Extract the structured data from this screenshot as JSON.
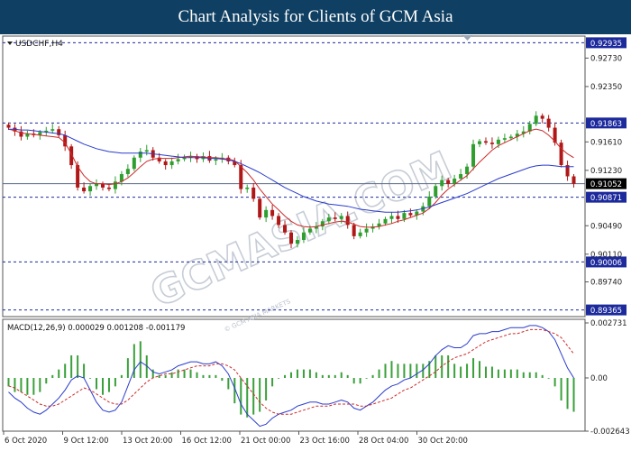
{
  "header": {
    "title": "Chart Analysis for Clients of GCM Asia"
  },
  "watermark": {
    "text": "GCMASIA.COM",
    "subtext": "© GCM ASIA MARKETS"
  },
  "colors": {
    "header_bg": "#0f3f62",
    "bull_candle": "#2e9e2e",
    "bear_candle": "#b01818",
    "ma_fast": "#cc2a2a",
    "ma_slow": "#2a3ccc",
    "level_line": "#1c2a9c",
    "price_line": "#5a6a8a",
    "macd_hist": "#3aa03a"
  },
  "chart_data": [
    {
      "type": "candlestick",
      "symbol": "USDCHF,H4",
      "ylim": [
        0.893,
        0.93
      ],
      "x_tick_labels": [
        "6 Oct 2020",
        "9 Oct 12:00",
        "13 Oct 20:00",
        "16 Oct 12:00",
        "21 Oct 00:00",
        "23 Oct 16:00",
        "28 Oct 04:00",
        "30 Oct 20:00"
      ],
      "y_tick_labels": [
        "0.92730",
        "0.92350",
        "0.91610",
        "0.91230",
        "0.90490",
        "0.90110",
        "0.89740"
      ],
      "levels": [
        {
          "value": 0.92935,
          "label": "0.92935"
        },
        {
          "value": 0.91863,
          "label": "0.91863"
        },
        {
          "value": 0.90871,
          "label": "0.90871"
        },
        {
          "value": 0.90006,
          "label": "0.90006"
        },
        {
          "value": 0.89365,
          "label": "0.89365"
        }
      ],
      "current_price": {
        "value": 0.91052,
        "label": "0.91052"
      },
      "series": [
        {
          "name": "close",
          "values": [
            0.918,
            0.9175,
            0.9168,
            0.9172,
            0.917,
            0.9174,
            0.9176,
            0.9178,
            0.917,
            0.9155,
            0.913,
            0.91,
            0.9095,
            0.9102,
            0.9105,
            0.91,
            0.9098,
            0.9108,
            0.9118,
            0.9125,
            0.914,
            0.9148,
            0.915,
            0.914,
            0.9135,
            0.913,
            0.9135,
            0.9138,
            0.914,
            0.9142,
            0.9138,
            0.9142,
            0.9136,
            0.9138,
            0.914,
            0.9135,
            0.913,
            0.9098,
            0.91,
            0.9085,
            0.906,
            0.907,
            0.9062,
            0.905,
            0.904,
            0.9025,
            0.903,
            0.904,
            0.9045,
            0.9048,
            0.9055,
            0.906,
            0.9058,
            0.9062,
            0.905,
            0.9035,
            0.904,
            0.9045,
            0.9048,
            0.9052,
            0.9058,
            0.9062,
            0.9058,
            0.9066,
            0.9063,
            0.9068,
            0.9075,
            0.9088,
            0.9102,
            0.911,
            0.9105,
            0.9112,
            0.9118,
            0.9128,
            0.9158,
            0.9162,
            0.916,
            0.9158,
            0.9164,
            0.9166,
            0.9168,
            0.9172,
            0.9175,
            0.9185,
            0.9196,
            0.9192,
            0.918,
            0.916,
            0.913,
            0.9115,
            0.9105
          ]
        },
        {
          "name": "MA(fast)",
          "values": [
            0.9178,
            0.9176,
            0.9173,
            0.9172,
            0.9171,
            0.917,
            0.9169,
            0.9168,
            0.9167,
            0.916,
            0.9145,
            0.9128,
            0.9116,
            0.9108,
            0.9105,
            0.9105,
            0.9104,
            0.9105,
            0.9108,
            0.9113,
            0.912,
            0.9128,
            0.9135,
            0.9138,
            0.9139,
            0.9139,
            0.9139,
            0.914,
            0.9141,
            0.9142,
            0.9141,
            0.9141,
            0.914,
            0.914,
            0.9139,
            0.9138,
            0.9136,
            0.9128,
            0.912,
            0.911,
            0.9098,
            0.9088,
            0.9078,
            0.907,
            0.9062,
            0.9055,
            0.905,
            0.9048,
            0.9047,
            0.9048,
            0.905,
            0.9052,
            0.9054,
            0.9055,
            0.9054,
            0.9051,
            0.9048,
            0.9047,
            0.9047,
            0.9048,
            0.905,
            0.9052,
            0.9055,
            0.9057,
            0.906,
            0.9063,
            0.9066,
            0.9072,
            0.908,
            0.909,
            0.9098,
            0.9104,
            0.911,
            0.9116,
            0.9125,
            0.9134,
            0.9142,
            0.915,
            0.9156,
            0.916,
            0.9164,
            0.9168,
            0.9172,
            0.9176,
            0.9178,
            0.9176,
            0.917,
            0.9162,
            0.9152,
            0.9145,
            0.914
          ]
        },
        {
          "name": "MA(slow)",
          "values": [
            0.9178,
            0.9178,
            0.9177,
            0.9177,
            0.9176,
            0.9175,
            0.9174,
            0.9173,
            0.9172,
            0.917,
            0.9166,
            0.9162,
            0.9158,
            0.9155,
            0.9152,
            0.915,
            0.9148,
            0.9147,
            0.9146,
            0.9146,
            0.9146,
            0.9146,
            0.9146,
            0.9145,
            0.9144,
            0.9143,
            0.9142,
            0.9141,
            0.914,
            0.914,
            0.914,
            0.914,
            0.9139,
            0.9139,
            0.9138,
            0.9137,
            0.9135,
            0.9132,
            0.9128,
            0.9124,
            0.912,
            0.9115,
            0.911,
            0.9105,
            0.91,
            0.9096,
            0.9092,
            0.9088,
            0.9085,
            0.9082,
            0.908,
            0.9078,
            0.9077,
            0.9076,
            0.9075,
            0.9073,
            0.9071,
            0.907,
            0.9069,
            0.9068,
            0.9067,
            0.9067,
            0.9067,
            0.9068,
            0.9069,
            0.907,
            0.9072,
            0.9074,
            0.9077,
            0.908,
            0.9083,
            0.9086,
            0.9089,
            0.9092,
            0.9096,
            0.91,
            0.9104,
            0.9108,
            0.9112,
            0.9115,
            0.9118,
            0.9121,
            0.9124,
            0.9127,
            0.9129,
            0.913,
            0.913,
            0.9129,
            0.9128,
            0.9128,
            0.9128
          ]
        }
      ]
    },
    {
      "type": "line",
      "title": "MACD(12,26,9) 0.000029 0.001208 -0.001179",
      "ylim": [
        -0.002643,
        0.002731
      ],
      "y_tick_labels": [
        "0.002731",
        "0.00",
        "-0.002643"
      ],
      "series": [
        {
          "name": "MACD",
          "values": [
            -0.0007,
            -0.001,
            -0.0012,
            -0.0015,
            -0.0017,
            -0.0018,
            -0.0016,
            -0.0013,
            -0.001,
            -0.0006,
            -0.0001,
            0.0001,
            0.0,
            -0.0006,
            -0.0012,
            -0.0016,
            -0.0017,
            -0.0016,
            -0.0012,
            -0.0004,
            0.0004,
            0.0008,
            0.0006,
            0.0003,
            0.0002,
            0.0003,
            0.0004,
            0.0006,
            0.0007,
            0.0008,
            0.0008,
            0.0007,
            0.0007,
            0.0008,
            0.0006,
            0.0002,
            -0.0005,
            -0.0013,
            -0.0018,
            -0.0021,
            -0.0024,
            -0.0023,
            -0.002,
            -0.0018,
            -0.0017,
            -0.0016,
            -0.0014,
            -0.0013,
            -0.0012,
            -0.0012,
            -0.0013,
            -0.0013,
            -0.0012,
            -0.0011,
            -0.0012,
            -0.0015,
            -0.0016,
            -0.0014,
            -0.0012,
            -0.0009,
            -0.0006,
            -0.0004,
            -0.0003,
            -0.0001,
            0.0,
            0.0002,
            0.0004,
            0.0007,
            0.0011,
            0.0014,
            0.0016,
            0.0015,
            0.0015,
            0.0017,
            0.0021,
            0.0022,
            0.0022,
            0.0023,
            0.0023,
            0.0024,
            0.0025,
            0.0025,
            0.0025,
            0.0026,
            0.0026,
            0.0025,
            0.0023,
            0.0019,
            0.0012,
            0.0005,
            0.0
          ]
        },
        {
          "name": "Signal",
          "values": [
            -0.0004,
            -0.0005,
            -0.0007,
            -0.0009,
            -0.0011,
            -0.0013,
            -0.0014,
            -0.0014,
            -0.0013,
            -0.0011,
            -0.0009,
            -0.0007,
            -0.0005,
            -0.0006,
            -0.0008,
            -0.001,
            -0.0012,
            -0.0013,
            -0.0013,
            -0.0011,
            -0.0008,
            -0.0005,
            -0.0002,
            0.0,
            0.0001,
            0.0002,
            0.0002,
            0.0003,
            0.0004,
            0.0005,
            0.0006,
            0.0006,
            0.0006,
            0.0007,
            0.0007,
            0.0006,
            0.0004,
            0.0,
            -0.0004,
            -0.0008,
            -0.0012,
            -0.0015,
            -0.0017,
            -0.0018,
            -0.0018,
            -0.0018,
            -0.0017,
            -0.0016,
            -0.0015,
            -0.0014,
            -0.0014,
            -0.0014,
            -0.0013,
            -0.0013,
            -0.0013,
            -0.0013,
            -0.0014,
            -0.0014,
            -0.0013,
            -0.0012,
            -0.0011,
            -0.001,
            -0.0008,
            -0.0006,
            -0.0005,
            -0.0003,
            -0.0001,
            0.0001,
            0.0003,
            0.0006,
            0.0008,
            0.001,
            0.0011,
            0.0012,
            0.0014,
            0.0016,
            0.0018,
            0.0019,
            0.002,
            0.0021,
            0.0022,
            0.0022,
            0.0023,
            0.0024,
            0.0024,
            0.0024,
            0.0023,
            0.0022,
            0.002,
            0.0016,
            0.0012
          ]
        }
      ]
    }
  ]
}
